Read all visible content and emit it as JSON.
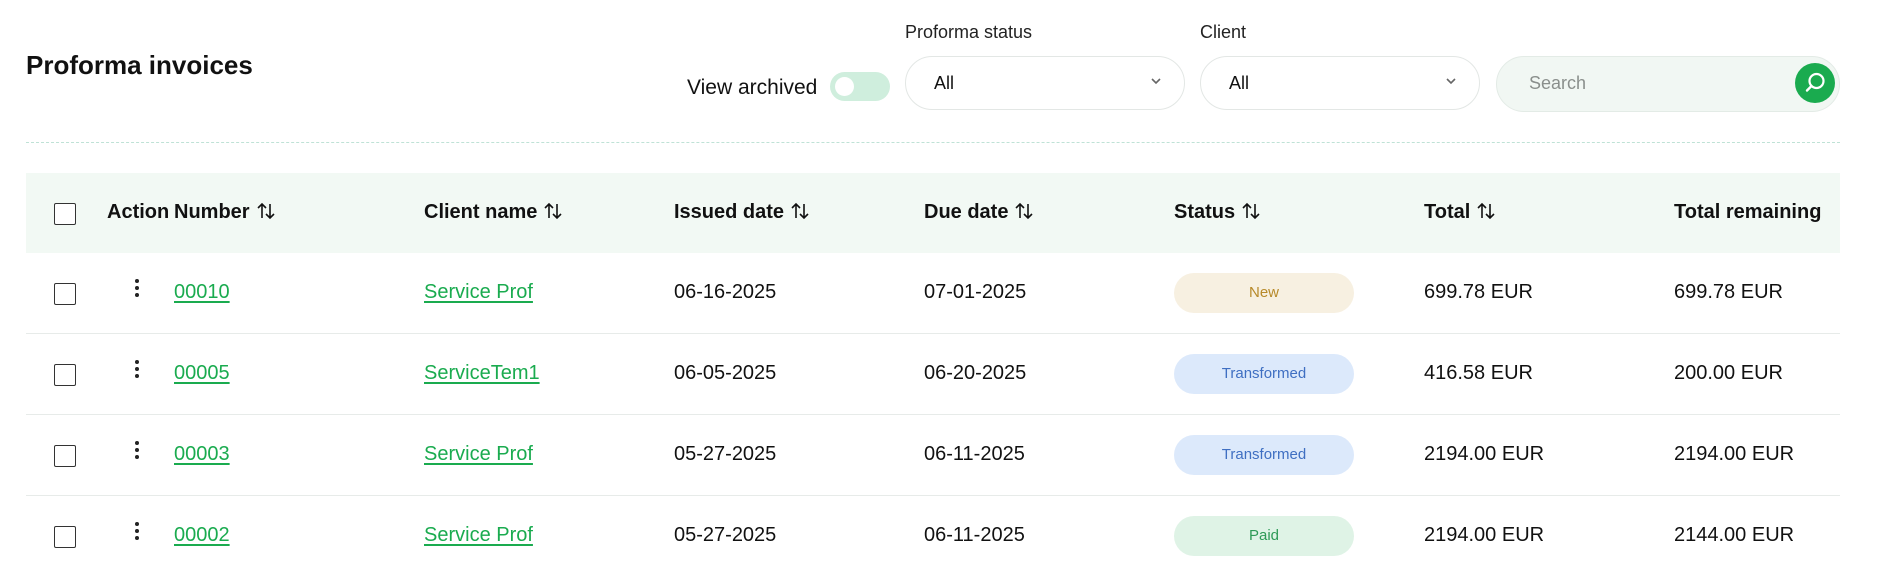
{
  "page": {
    "title": "Proforma invoices"
  },
  "filters": {
    "view_archived_label": "View archived",
    "view_archived_on": false,
    "proforma_status": {
      "label": "Proforma status",
      "value": "All"
    },
    "client": {
      "label": "Client",
      "value": "All"
    },
    "search": {
      "placeholder": "Search",
      "value": ""
    }
  },
  "colors": {
    "accent": "#1aab4f",
    "header_bg": "#f2f9f4"
  },
  "table": {
    "columns": [
      "Action",
      "Number",
      "Client name",
      "Issued date",
      "Due date",
      "Status",
      "Total",
      "Total remaining"
    ],
    "rows": [
      {
        "number": "00010",
        "client": "Service Prof",
        "issued": "06-16-2025",
        "due": "07-01-2025",
        "status": "New",
        "total": "699.78 EUR",
        "remaining": "699.78 EUR"
      },
      {
        "number": "00005",
        "client": "ServiceTem1",
        "issued": "06-05-2025",
        "due": "06-20-2025",
        "status": "Transformed",
        "total": "416.58 EUR",
        "remaining": "200.00 EUR"
      },
      {
        "number": "00003",
        "client": "Service Prof",
        "issued": "05-27-2025",
        "due": "06-11-2025",
        "status": "Transformed",
        "total": "2194.00 EUR",
        "remaining": "2194.00 EUR"
      },
      {
        "number": "00002",
        "client": "Service Prof",
        "issued": "05-27-2025",
        "due": "06-11-2025",
        "status": "Paid",
        "total": "2194.00 EUR",
        "remaining": "2144.00 EUR"
      }
    ]
  },
  "status_colors": {
    "New": {
      "bg": "#f7f0e1",
      "fg": "#b78a2a"
    },
    "Transformed": {
      "bg": "#dce9fb",
      "fg": "#3f6fc2"
    },
    "Paid": {
      "bg": "#dff3e6",
      "fg": "#2e9a57"
    }
  }
}
